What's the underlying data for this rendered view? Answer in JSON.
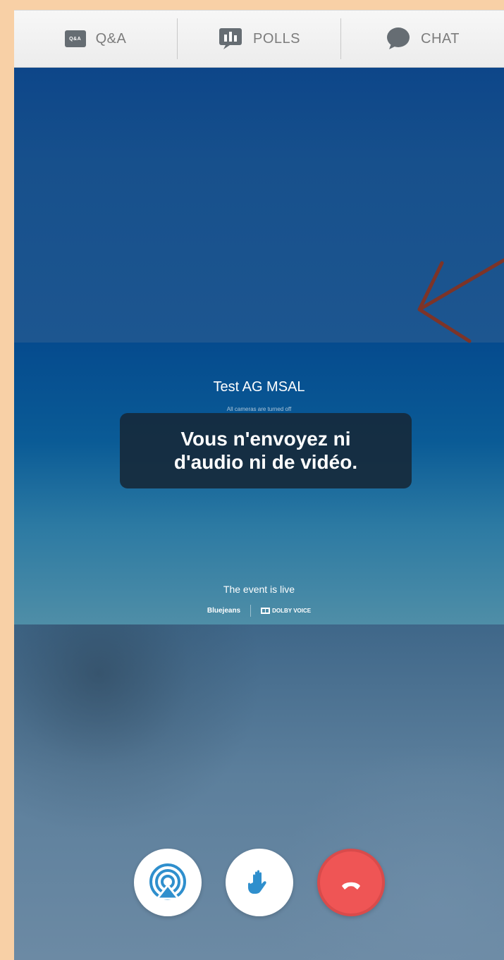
{
  "tabs": [
    {
      "label": "Q&A",
      "icon": "qa-icon",
      "badge": "Q&A"
    },
    {
      "label": "POLLS",
      "icon": "polls-icon"
    },
    {
      "label": "CHAT",
      "icon": "chat-icon"
    }
  ],
  "event": {
    "title": "Test AG MSAL",
    "subtitle": "All cameras are turned off",
    "notice": "Vous n'envoyez ni d'audio ni de vidéo.",
    "status": "The event is live",
    "brand_primary": "Bluejeans",
    "brand_secondary": "DOLBY VOICE"
  },
  "controls": [
    {
      "name": "airplay-button",
      "icon": "airplay-icon"
    },
    {
      "name": "raise-hand-button",
      "icon": "hand-icon"
    },
    {
      "name": "end-call-button",
      "icon": "phone-hangup-icon"
    }
  ],
  "colors": {
    "tab_text": "#7c7c7c",
    "header_bg": "#f2f2f2",
    "accent_blue": "#2f8fcd",
    "end_call_red": "#ef5555",
    "annotation_arrow": "#7d3428"
  }
}
